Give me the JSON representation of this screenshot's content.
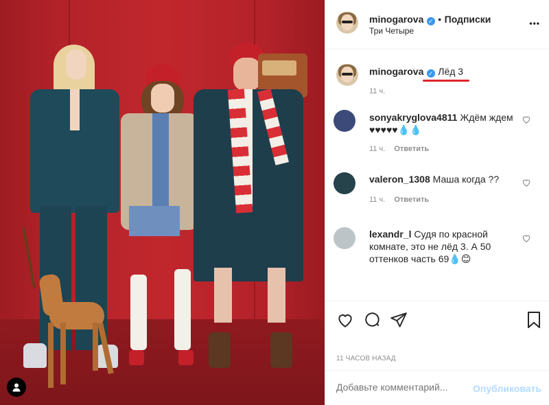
{
  "post": {
    "author": "minogarova",
    "follow_label": "Подписки",
    "location": "Три Четыре",
    "caption": "Лёд 3",
    "caption_time": "11 ч.",
    "comments": [
      {
        "user": "sonyakryglova4811",
        "text": "Ждём ждем",
        "text2": "♥♥♥♥♥💧💧",
        "time": "11 ч.",
        "reply": "Ответить"
      },
      {
        "user": "valeron_1308",
        "text": "Маша когда ??",
        "time": "11 ч.",
        "reply": "Ответить"
      },
      {
        "user": "lexandr_l",
        "text": "Судя по красной комнате, это не лёд 3. А 50 оттенков часть 69💧😊"
      }
    ],
    "timestamp": "11 ЧАСОВ НАЗАД",
    "comment_placeholder": "Добавьте комментарий...",
    "publish_label": "Опубликовать",
    "more_label": "•••"
  },
  "colors": {
    "verified": "#3897f0",
    "publish_disabled": "#b3dbff",
    "annotation": "#e0242b"
  },
  "icons": {
    "verified": "✓",
    "heart": "heart-icon",
    "comment": "comment-icon",
    "share": "share-icon",
    "save": "bookmark-icon",
    "user_tag": "user-tag-icon"
  }
}
